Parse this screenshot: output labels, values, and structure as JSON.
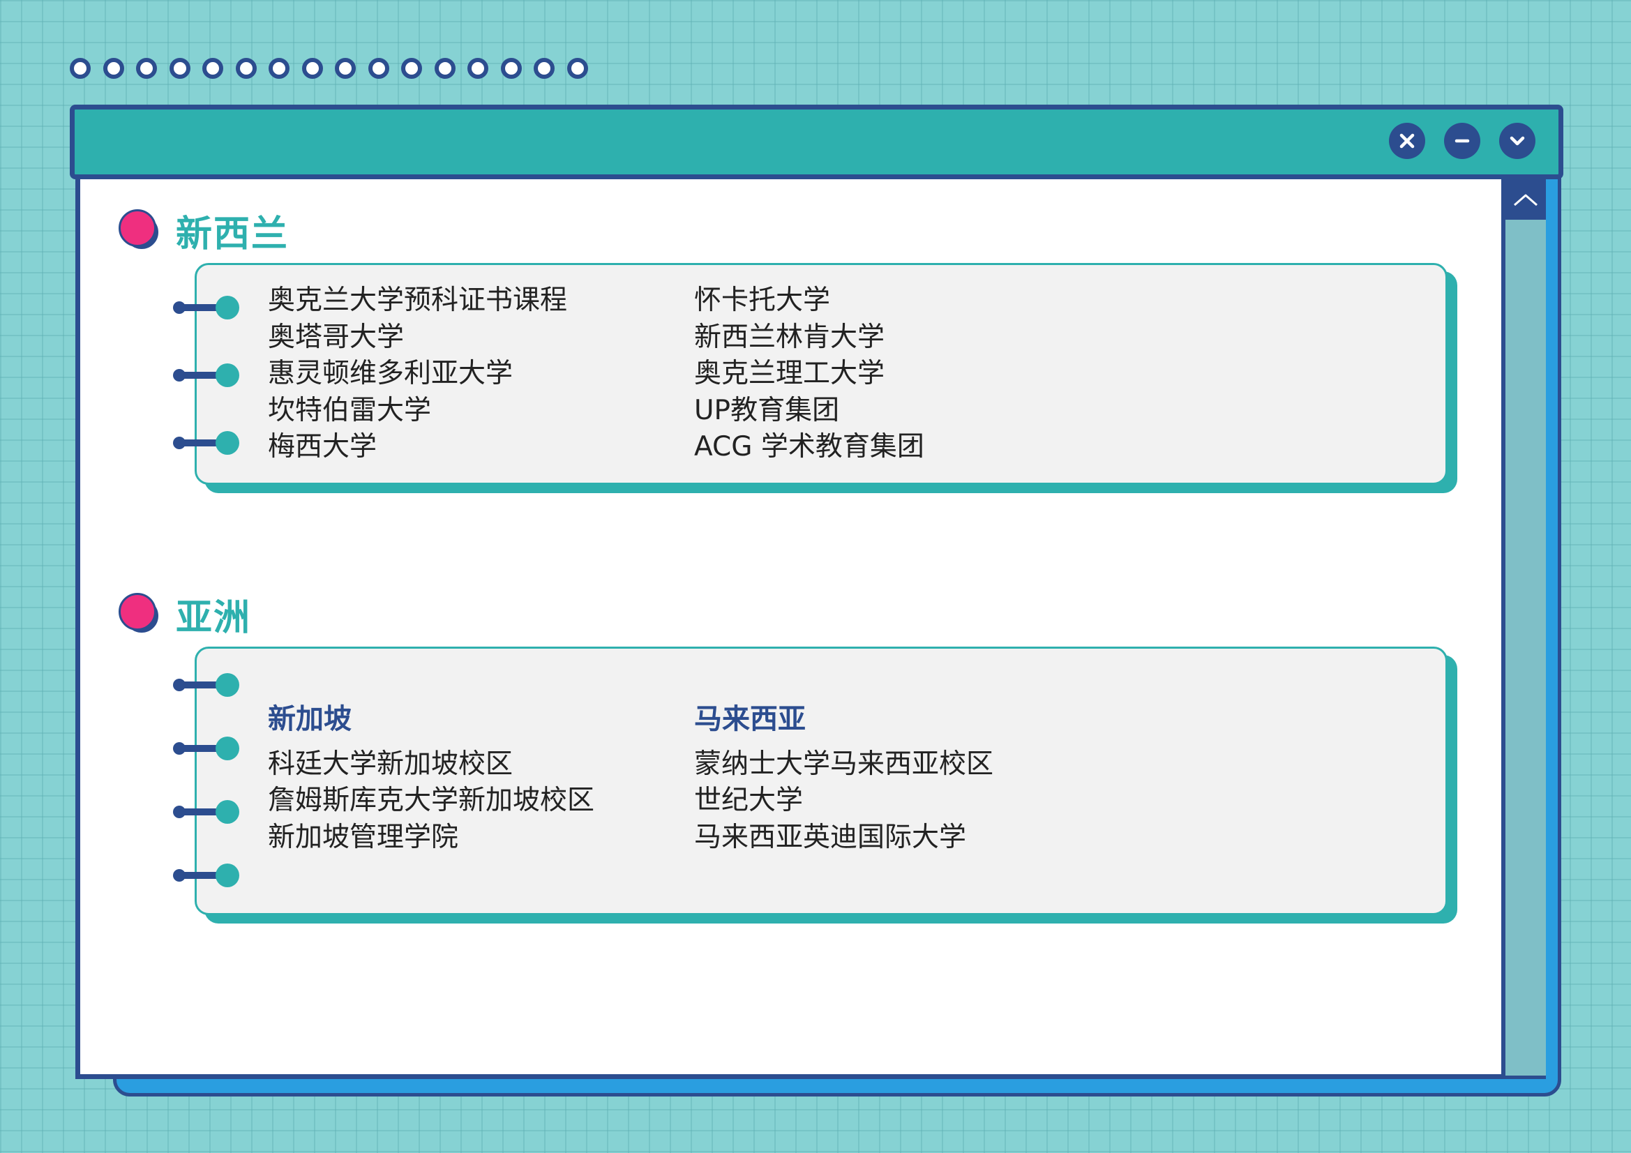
{
  "window": {
    "controls": [
      {
        "name": "close",
        "icon": "close-icon"
      },
      {
        "name": "minimize",
        "icon": "minus-icon"
      },
      {
        "name": "dropdown",
        "icon": "chevron-down-icon"
      }
    ],
    "scrollbar": {
      "up_icon": "chevron-up-icon"
    }
  },
  "colors": {
    "background": "#86d2d3",
    "navy": "#2c4d8f",
    "teal": "#2eb0ae",
    "pink": "#ef2f7f",
    "blue_shadow": "#2a9ee0",
    "card_bg": "#f2f2f2"
  },
  "sections": {
    "nz": {
      "title": "新西兰",
      "left": [
        "奥克兰大学预科证书课程",
        "奥塔哥大学",
        "惠灵顿维多利亚大学",
        "坎特伯雷大学",
        "梅西大学"
      ],
      "right": [
        "怀卡托大学",
        "新西兰林肯大学",
        "奥克兰理工大学",
        "UP教育集团",
        "ACG 学术教育集团"
      ]
    },
    "asia": {
      "title": "亚洲",
      "left_heading": "新加坡",
      "left": [
        "科廷大学新加坡校区",
        "詹姆斯库克大学新加坡校区",
        "新加坡管理学院"
      ],
      "right_heading": "马来西亚",
      "right": [
        "蒙纳士大学马来西亚校区",
        "世纪大学",
        "马来西亚英迪国际大学"
      ]
    }
  }
}
